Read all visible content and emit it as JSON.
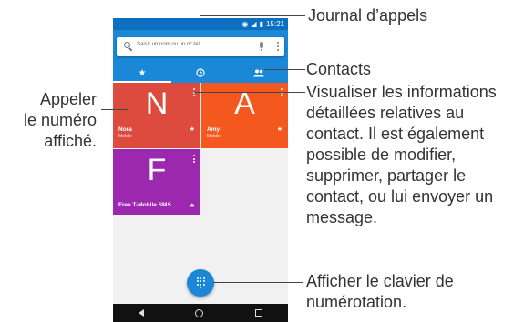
{
  "status": {
    "time": "15:21"
  },
  "search": {
    "placeholder": "Saisir un nom ou un n° tél."
  },
  "tiles": [
    {
      "letter": "N",
      "name": "Nora",
      "sub": "Mobile",
      "color": "#dc4b3d"
    },
    {
      "letter": "A",
      "name": "Amy",
      "sub": "Mobile",
      "color": "#f4581f"
    },
    {
      "letter": "F",
      "name": "Free T-Mobile SMS..",
      "sub": "",
      "color": "#9c28b0"
    }
  ],
  "callouts": {
    "journal": "Journal d’appels",
    "contacts": "Contacts",
    "appeler": [
      "Appeler",
      "le numéro",
      "affiché."
    ],
    "visualiser": [
      "Visualiser les informations",
      "détaillées relatives au",
      "contact. Il est également",
      "possible de modifier,",
      "supprimer, partager le",
      "contact, ou lui envoyer un",
      "message."
    ],
    "clavier": [
      "Afficher le clavier de",
      "numérotation."
    ]
  },
  "colors": {
    "appbar": "#1a88d6",
    "statusbar": "#0d6fc0"
  }
}
